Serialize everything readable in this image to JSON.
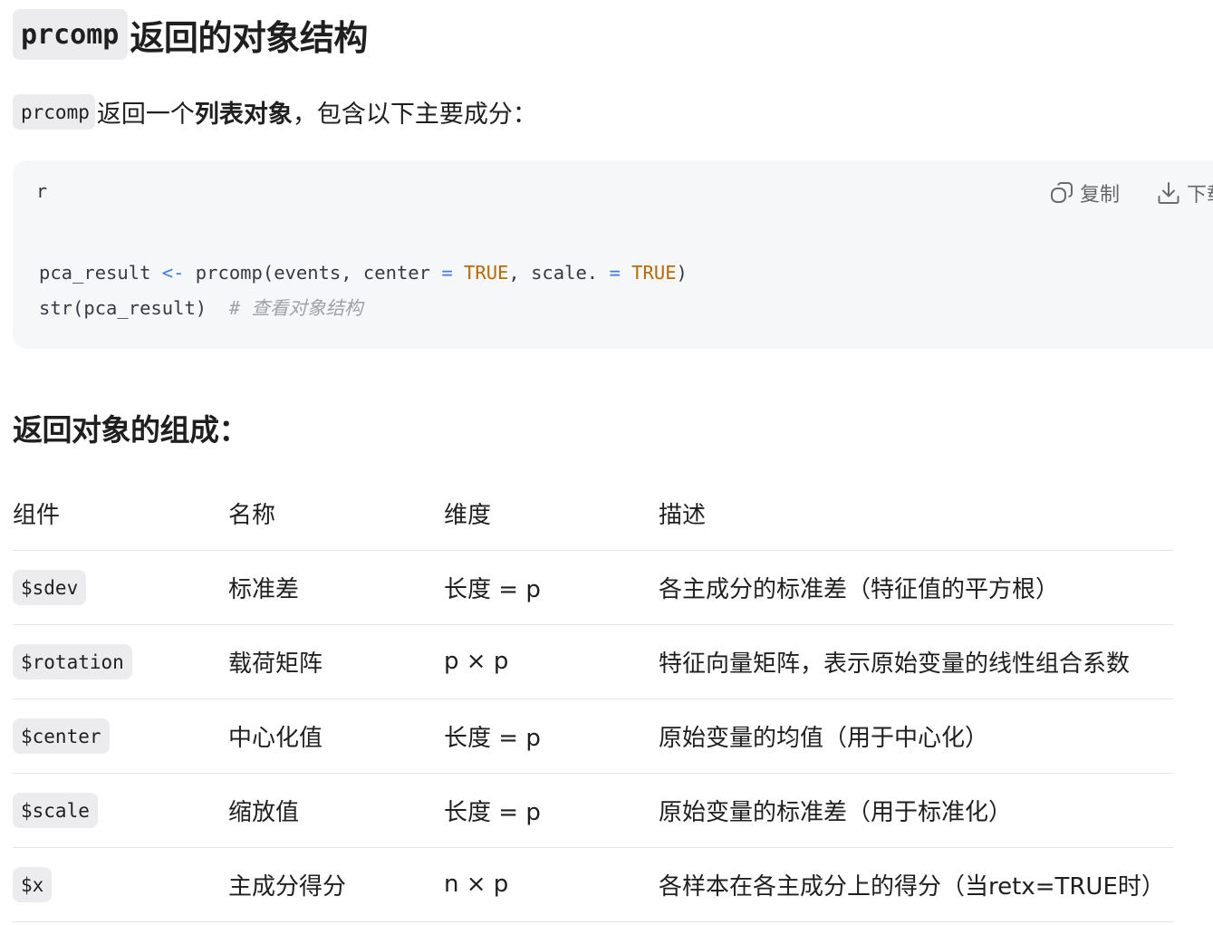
{
  "heading": {
    "code": "prcomp",
    "text": "返回的对象结构"
  },
  "intro": {
    "code": "prcomp",
    "before_bold": "返回一个",
    "bold": "列表对象",
    "after_bold": "，包含以下主要成分："
  },
  "code_block": {
    "language": "r",
    "copy_label": "复制",
    "download_label": "下载",
    "line1": {
      "var": "pca_result ",
      "assign": "<-",
      "call": " prcomp(events, center ",
      "eq1": "=",
      "true1": "TRUE",
      "mid": ", scale. ",
      "eq2": "=",
      "true2": "TRUE",
      "end": ")"
    },
    "line2": {
      "code": "str(pca_result)  ",
      "comment": "# 查看对象结构"
    }
  },
  "section_heading": "返回对象的组成：",
  "table": {
    "headers": [
      "组件",
      "名称",
      "维度",
      "描述"
    ],
    "rows": [
      {
        "component": "$sdev",
        "name": "标准差",
        "dim": "长度 = p",
        "desc": "各主成分的标准差（特征值的平方根）"
      },
      {
        "component": "$rotation",
        "name": "载荷矩阵",
        "dim": "p × p",
        "desc": "特征向量矩阵，表示原始变量的线性组合系数"
      },
      {
        "component": "$center",
        "name": "中心化值",
        "dim": "长度 = p",
        "desc": "原始变量的均值（用于中心化）"
      },
      {
        "component": "$scale",
        "name": "缩放值",
        "dim": "长度 = p",
        "desc": "原始变量的标准差（用于标准化）"
      },
      {
        "component": "$x",
        "name": "主成分得分",
        "dim": "n × p",
        "desc": "各样本在各主成分上的得分（当retx=TRUE时）"
      }
    ]
  }
}
